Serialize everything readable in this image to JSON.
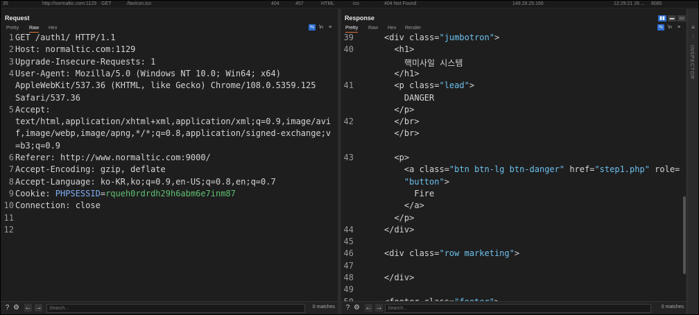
{
  "history_row": {
    "num": "35",
    "host": "http://normaltic.com:1129",
    "method": "GET",
    "url": "/favicon.ico",
    "status": "404",
    "length": "457",
    "mime": "HTML",
    "ext": "ico",
    "title": "404 Not Found",
    "ip": "149.28.25.166",
    "time": "12:29:21 26 ...",
    "port": "8080"
  },
  "request": {
    "title": "Request",
    "tabs": [
      "Pretty",
      "Raw",
      "Hex"
    ],
    "active_tab": "Raw",
    "lines": [
      {
        "n": "1",
        "parts": [
          {
            "t": "GET /auth1/ HTTP/1.1",
            "c": "txt"
          }
        ]
      },
      {
        "n": "2",
        "parts": [
          {
            "t": "Host: ",
            "c": "key"
          },
          {
            "t": "normaltic.com:1129",
            "c": "val"
          }
        ]
      },
      {
        "n": "3",
        "parts": [
          {
            "t": "Upgrade-Insecure-Requests: ",
            "c": "key"
          },
          {
            "t": "1",
            "c": "val"
          }
        ]
      },
      {
        "n": "4",
        "parts": [
          {
            "t": "User-Agent: ",
            "c": "key"
          },
          {
            "t": "Mozilla/5.0 (Windows NT 10.0; Win64; x64)",
            "c": "val"
          }
        ]
      },
      {
        "n": "",
        "parts": [
          {
            "t": "AppleWebKit/537.36 (KHTML, like Gecko) Chrome/108.0.5359.125",
            "c": "val"
          }
        ]
      },
      {
        "n": "",
        "parts": [
          {
            "t": "Safari/537.36",
            "c": "val"
          }
        ]
      },
      {
        "n": "5",
        "parts": [
          {
            "t": "Accept:",
            "c": "key"
          }
        ]
      },
      {
        "n": "",
        "parts": [
          {
            "t": "text/html,application/xhtml+xml,application/xml;q=0.9,image/avi",
            "c": "val"
          }
        ]
      },
      {
        "n": "",
        "parts": [
          {
            "t": "f,image/webp,image/apng,*/*;q=0.8,application/signed-exchange;v",
            "c": "val"
          }
        ]
      },
      {
        "n": "",
        "parts": [
          {
            "t": "=b3;q=0.9",
            "c": "val"
          }
        ]
      },
      {
        "n": "6",
        "parts": [
          {
            "t": "Referer: ",
            "c": "key"
          },
          {
            "t": "http://www.normaltic.com:9000/",
            "c": "val"
          }
        ]
      },
      {
        "n": "7",
        "parts": [
          {
            "t": "Accept-Encoding: ",
            "c": "key"
          },
          {
            "t": "gzip, deflate",
            "c": "val"
          }
        ]
      },
      {
        "n": "8",
        "parts": [
          {
            "t": "Accept-Language: ",
            "c": "key"
          },
          {
            "t": "ko-KR,ko;q=0.9,en-US;q=0.8,en;q=0.7",
            "c": "val"
          }
        ]
      },
      {
        "n": "9",
        "parts": [
          {
            "t": "Cookie: ",
            "c": "key"
          },
          {
            "t": "PHPSESSID",
            "c": "cookie-name"
          },
          {
            "t": "=",
            "c": "key"
          },
          {
            "t": "rqueh0rdrdh29h6abm6e7inm87",
            "c": "cookie-val"
          }
        ]
      },
      {
        "n": "10",
        "parts": [
          {
            "t": "Connection: ",
            "c": "key"
          },
          {
            "t": "close",
            "c": "val"
          }
        ]
      },
      {
        "n": "11",
        "parts": []
      },
      {
        "n": "12",
        "parts": []
      }
    ],
    "search_placeholder": "Search...",
    "matches": "0 matches"
  },
  "response": {
    "title": "Response",
    "tabs": [
      "Pretty",
      "Raw",
      "Hex",
      "Render"
    ],
    "active_tab": "Pretty",
    "lines": [
      {
        "n": "39",
        "parts": [
          {
            "t": "<div class=",
            "c": "tag"
          },
          {
            "t": "\"jumbotron\"",
            "c": "str"
          },
          {
            "t": ">",
            "c": "tag"
          }
        ]
      },
      {
        "n": "40",
        "parts": [
          {
            "t": "  <h1>",
            "c": "tag"
          }
        ]
      },
      {
        "n": "",
        "parts": [
          {
            "t": "    핵미사일 시스템",
            "c": "txt"
          }
        ]
      },
      {
        "n": "",
        "parts": [
          {
            "t": "  </h1>",
            "c": "tag"
          }
        ]
      },
      {
        "n": "41",
        "parts": [
          {
            "t": "  <p class=",
            "c": "tag"
          },
          {
            "t": "\"lead\"",
            "c": "str"
          },
          {
            "t": ">",
            "c": "tag"
          }
        ]
      },
      {
        "n": "",
        "parts": [
          {
            "t": "    DANGER",
            "c": "txt"
          }
        ]
      },
      {
        "n": "",
        "parts": [
          {
            "t": "  </p>",
            "c": "tag"
          }
        ]
      },
      {
        "n": "42",
        "parts": [
          {
            "t": "  </br>",
            "c": "tag"
          }
        ]
      },
      {
        "n": "",
        "parts": [
          {
            "t": "  </br>",
            "c": "tag"
          }
        ]
      },
      {
        "n": "",
        "parts": []
      },
      {
        "n": "43",
        "parts": [
          {
            "t": "  <p>",
            "c": "tag"
          }
        ]
      },
      {
        "n": "",
        "parts": [
          {
            "t": "    <a class=",
            "c": "tag"
          },
          {
            "t": "\"btn btn-lg btn-danger\"",
            "c": "str"
          },
          {
            "t": " href=",
            "c": "tag"
          },
          {
            "t": "\"step1.php\"",
            "c": "str"
          },
          {
            "t": " role=",
            "c": "tag"
          }
        ]
      },
      {
        "n": "",
        "parts": [
          {
            "t": "    ",
            "c": "tag"
          },
          {
            "t": "\"button\"",
            "c": "str"
          },
          {
            "t": ">",
            "c": "tag"
          }
        ]
      },
      {
        "n": "",
        "parts": [
          {
            "t": "      Fire",
            "c": "txt"
          }
        ]
      },
      {
        "n": "",
        "parts": [
          {
            "t": "    </a>",
            "c": "tag"
          }
        ]
      },
      {
        "n": "",
        "parts": [
          {
            "t": "  </p>",
            "c": "tag"
          }
        ]
      },
      {
        "n": "44",
        "parts": [
          {
            "t": "</div>",
            "c": "tag"
          }
        ]
      },
      {
        "n": "45",
        "parts": []
      },
      {
        "n": "46",
        "parts": [
          {
            "t": "<div class=",
            "c": "tag"
          },
          {
            "t": "\"row marketing\"",
            "c": "str"
          },
          {
            "t": ">",
            "c": "tag"
          }
        ]
      },
      {
        "n": "47",
        "parts": []
      },
      {
        "n": "48",
        "parts": [
          {
            "t": "</div>",
            "c": "tag"
          }
        ]
      },
      {
        "n": "49",
        "parts": []
      },
      {
        "n": "50",
        "parts": [
          {
            "t": "<footer class=",
            "c": "tag"
          },
          {
            "t": "\"footer\"",
            "c": "str"
          },
          {
            "t": ">",
            "c": "tag"
          }
        ]
      }
    ],
    "search_placeholder": "Search...",
    "matches": "0 matches"
  },
  "inspector_label": "INSPECTOR",
  "icons": {
    "help": "help-icon",
    "settings": "gear-icon",
    "back": "arrow-left-icon",
    "forward": "arrow-right-icon",
    "wrap": "wrap-lines-icon",
    "newline": "newline-icon",
    "menu": "menu-icon"
  }
}
